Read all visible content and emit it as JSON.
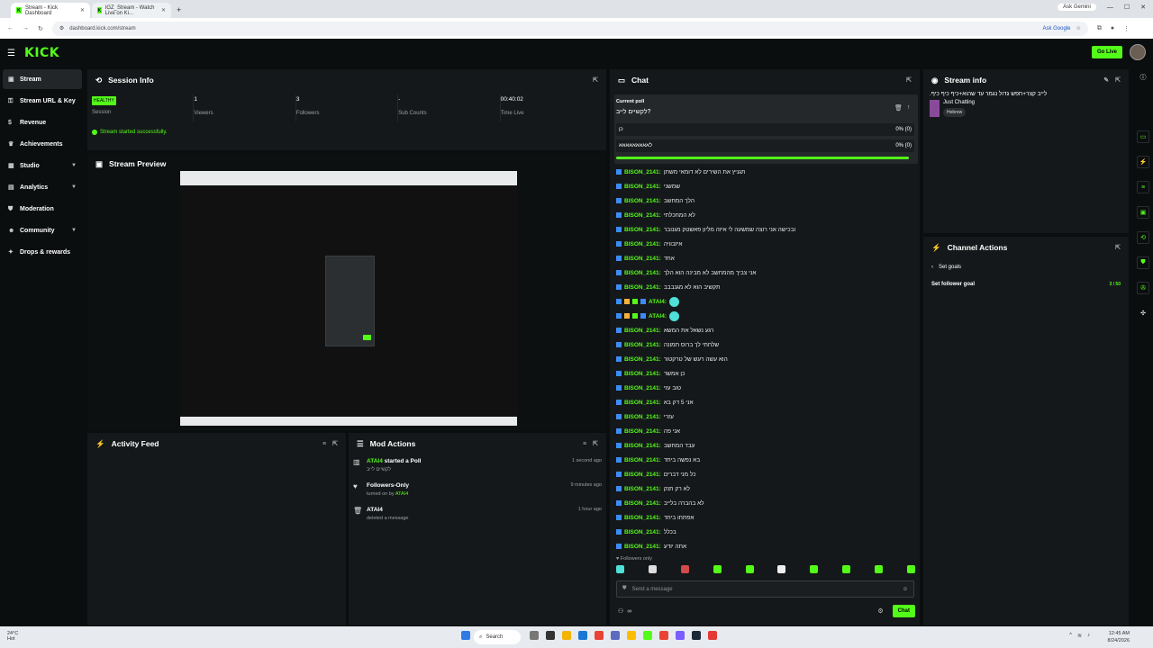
{
  "browser": {
    "tabs": [
      {
        "label": "Stream - Kick Dashboard"
      },
      {
        "label": "IGZ_Stream - Watch Live on Ki..."
      }
    ],
    "new_tab": "+",
    "ask_gemini": "Ask Gemini",
    "url": "dashboard.kick.com/stream",
    "ask_google": "Ask Google"
  },
  "top": {
    "logo": "KICK",
    "go_live": "Go Live"
  },
  "sidebar": {
    "items": [
      {
        "label": "Stream",
        "icon": "stream-icon"
      },
      {
        "label": "Stream URL & Key",
        "icon": "key-icon"
      },
      {
        "label": "Revenue",
        "icon": "dollar-icon"
      },
      {
        "label": "Achievements",
        "icon": "trophy-icon"
      },
      {
        "label": "Studio",
        "icon": "studio-icon"
      },
      {
        "label": "Analytics",
        "icon": "chart-icon"
      },
      {
        "label": "Moderation",
        "icon": "shield-icon"
      },
      {
        "label": "Community",
        "icon": "users-icon"
      },
      {
        "label": "Drops & rewards",
        "icon": "gift-icon"
      }
    ]
  },
  "session": {
    "title": "Session Info",
    "badge": "HEALTHY",
    "stats": [
      {
        "value": "",
        "label": "Session"
      },
      {
        "value": "1",
        "label": "Viewers"
      },
      {
        "value": "3",
        "label": "Followers"
      },
      {
        "value": "-",
        "label": "Sub Counts"
      },
      {
        "value": "00:40:02",
        "label": "Time Live"
      }
    ],
    "status": "Stream started successfully."
  },
  "preview": {
    "title": "Stream Preview"
  },
  "activity": {
    "title": "Activity Feed"
  },
  "mod_actions": {
    "title": "Mod Actions",
    "items": [
      {
        "user": "ATAI4",
        "text": "started a Poll",
        "sub": "לקשיים לייב",
        "time": "1 second ago"
      },
      {
        "user": "",
        "text": "Followers-Only",
        "sub_prefix": "turned on by",
        "sub_user": "ATAI4",
        "time": "9 minutes ago"
      },
      {
        "user": "",
        "text": "ATAI4",
        "sub": "deleted a message",
        "time": "1 hour ago"
      }
    ]
  },
  "chat": {
    "title": "Chat",
    "poll": {
      "label": "Current poll",
      "question": "לקשיים לייב?",
      "options": [
        {
          "text": "כן",
          "pct": "0% (0)"
        },
        {
          "text": "לאאאאאאאאא",
          "pct": "0% (0)"
        }
      ]
    },
    "messages": [
      {
        "user": "BISON_2141:",
        "text": "תגניץ את השירים לא דומאי משתן"
      },
      {
        "user": "BISON_2141:",
        "text": "שמשני"
      },
      {
        "user": "BISON_2141:",
        "text": "הלך המחשב"
      },
      {
        "user": "BISON_2141:",
        "text": "לא המחכלתי"
      },
      {
        "user": "BISON_2141:",
        "text": "ובכישה אני רוצה שמשעה לי איזה מליון פאשטק מגנובר"
      },
      {
        "user": "BISON_2141:",
        "text": "איזבוויה"
      },
      {
        "user": "BISON_2141:",
        "text": "אחד"
      },
      {
        "user": "BISON_2141:",
        "text": "אני צביך מהמחשב לא מבינה הוא הלך"
      },
      {
        "user": "BISON_2141:",
        "text": "תקשיב הוא לא מגנבבב"
      },
      {
        "user": "ATAI4:",
        "text": "",
        "emote": true
      },
      {
        "user": "ATAI4:",
        "text": "",
        "emote": true
      },
      {
        "user": "BISON_2141:",
        "text": "רגע נשאל את המשא"
      },
      {
        "user": "BISON_2141:",
        "text": "שלחתי לך ברוס תמונה"
      },
      {
        "user": "BISON_2141:",
        "text": "הוא עשה רעש של טרקטור"
      },
      {
        "user": "BISON_2141:",
        "text": "כן אמשר"
      },
      {
        "user": "BISON_2141:",
        "text": "טוב עזי"
      },
      {
        "user": "BISON_2141:",
        "text": "אני 5 דק בא"
      },
      {
        "user": "BISON_2141:",
        "text": "עזרי"
      },
      {
        "user": "BISON_2141:",
        "text": "אני פה"
      },
      {
        "user": "BISON_2141:",
        "text": "עבד המחשב"
      },
      {
        "user": "BISON_2141:",
        "text": "בא נפשה ביחד"
      },
      {
        "user": "BISON_2141:",
        "text": "כל מני דברים"
      },
      {
        "user": "BISON_2141:",
        "text": "לא רק תנק"
      },
      {
        "user": "BISON_2141:",
        "text": "לא בהברה בלייב"
      },
      {
        "user": "BISON_2141:",
        "text": "אפתחו ביחד"
      },
      {
        "user": "BISON_2141:",
        "text": "בכלל"
      },
      {
        "user": "BISON_2141:",
        "text": "אתה יודע"
      }
    ],
    "followers_only": "Followers only",
    "input_placeholder": "Send a message",
    "count": "∞",
    "send_label": "Chat"
  },
  "stream_info": {
    "title": "Stream info",
    "stream_title": "לייב קצר+חפש גדול נגמר עד שהוא+כיף כיף כיף.",
    "category": "Just Chatting",
    "language": "Hebrew"
  },
  "channel_actions": {
    "title": "Channel Actions",
    "back": "Set goals",
    "goal_label": "Set follower goal",
    "goal_value": "3 / 50"
  },
  "taskbar": {
    "weather_temp": "24°C",
    "weather_desc": "Hot",
    "search": "Search",
    "time": "12:45 AM",
    "date": "8/24/2026"
  },
  "colors": {
    "accent": "#53fc18",
    "panel": "#15181a",
    "bg": "#0b0e0f"
  }
}
